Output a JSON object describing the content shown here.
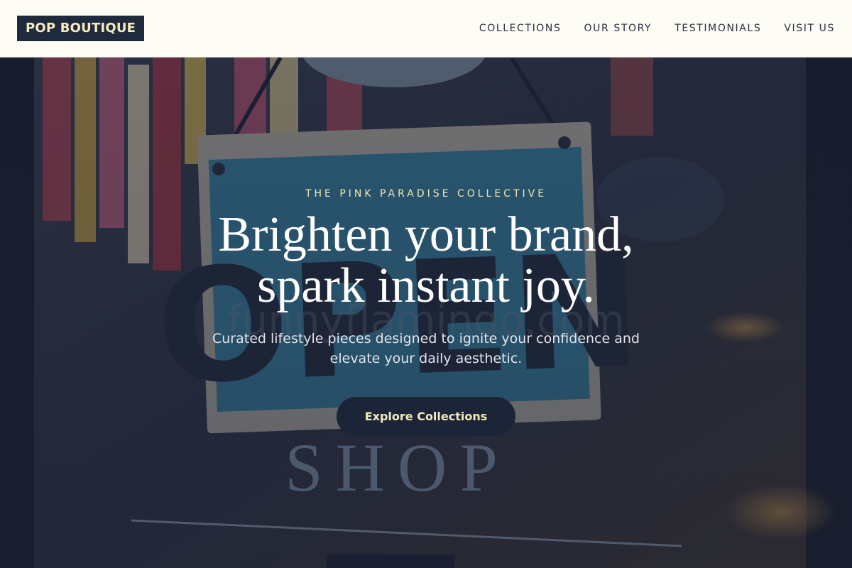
{
  "header": {
    "logo": "POP BOUTIQUE",
    "nav": [
      {
        "label": "COLLECTIONS"
      },
      {
        "label": "OUR STORY"
      },
      {
        "label": "TESTIMONIALS"
      },
      {
        "label": "VISIT US"
      }
    ]
  },
  "hero": {
    "eyebrow": "THE PINK PARADISE COLLECTIVE",
    "headline_line1": "Brighten your brand,",
    "headline_line2": "spark instant joy.",
    "subtext": "Curated lifestyle pieces designed to ignite your confidence and elevate your daily aesthetic.",
    "cta_label": "Explore Collections",
    "background": {
      "sign_text": "OPEN",
      "window_text": "SHOP",
      "watermark": "funnyflamingo.com"
    }
  },
  "colors": {
    "header_bg": "#fdfcf5",
    "logo_bg": "#1f2a3d",
    "logo_text": "#f6ecc0",
    "accent": "#f2e6b0",
    "cta_bg": "#1c2538"
  }
}
